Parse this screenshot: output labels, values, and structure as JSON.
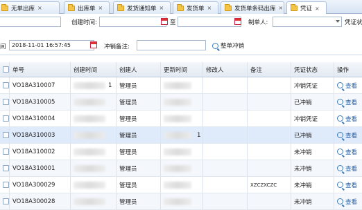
{
  "tabs": [
    {
      "label": "无单出库",
      "active": false
    },
    {
      "label": "出库单",
      "active": false
    },
    {
      "label": "发货通知单",
      "active": false
    },
    {
      "label": "发货单",
      "active": false
    },
    {
      "label": "发货单条码出库",
      "active": false
    },
    {
      "label": "凭证",
      "active": true
    }
  ],
  "tab_close_glyph": "×",
  "filters": {
    "created_time_label": "创建时间:",
    "to_label": "至",
    "creator_label": "制单人:",
    "voucher_label": "凭证状",
    "date_label": "间",
    "date_value": "2018-11-01 16:57:45",
    "reversal_note_label": "冲销备注:",
    "reversal_button": "整单冲销"
  },
  "table": {
    "headers": [
      "单号",
      "创建时间",
      "创建人",
      "更新时间",
      "修改人",
      "备注",
      "凭证状态",
      "操作"
    ],
    "rows": [
      {
        "no": "VO18A310007",
        "created_suffix": "1",
        "creator": "管理员",
        "updated_suffix": "",
        "remark": "",
        "status": "冲销凭证",
        "action": "查看"
      },
      {
        "no": "VO18A310005",
        "created_suffix": "",
        "creator": "管理员",
        "updated_suffix": "",
        "remark": "",
        "status": "已冲销",
        "action": "查看"
      },
      {
        "no": "VO18A310004",
        "created_suffix": "",
        "creator": "管理员",
        "updated_suffix": "",
        "remark": "",
        "status": "冲销凭证",
        "action": "查看"
      },
      {
        "no": "VO18A310003",
        "created_suffix": "",
        "creator": "管理员",
        "updated_suffix": "1",
        "remark": "",
        "status": "已冲销",
        "action": "查看"
      },
      {
        "no": "VO18A310002",
        "created_suffix": "",
        "creator": "管理员",
        "updated_suffix": "",
        "remark": "",
        "status": "未冲销",
        "action": "查看"
      },
      {
        "no": "VO18A310001",
        "created_suffix": "",
        "creator": "管理员",
        "updated_suffix": "",
        "remark": "",
        "status": "未冲销",
        "action": "查看"
      },
      {
        "no": "VO18A300029",
        "created_suffix": "",
        "creator": "管理员",
        "updated_suffix": "",
        "remark": "XZCZXCZC",
        "status": "未冲销",
        "action": "查看"
      },
      {
        "no": "VO18A300028",
        "created_suffix": "",
        "creator": "管理员",
        "updated_suffix": "",
        "remark": "",
        "status": "未冲销",
        "action": "查看"
      }
    ]
  },
  "colors": {
    "link": "#1f5aa6",
    "header_bg": "#e3eaf3",
    "selected_row": "#dfeafa"
  }
}
